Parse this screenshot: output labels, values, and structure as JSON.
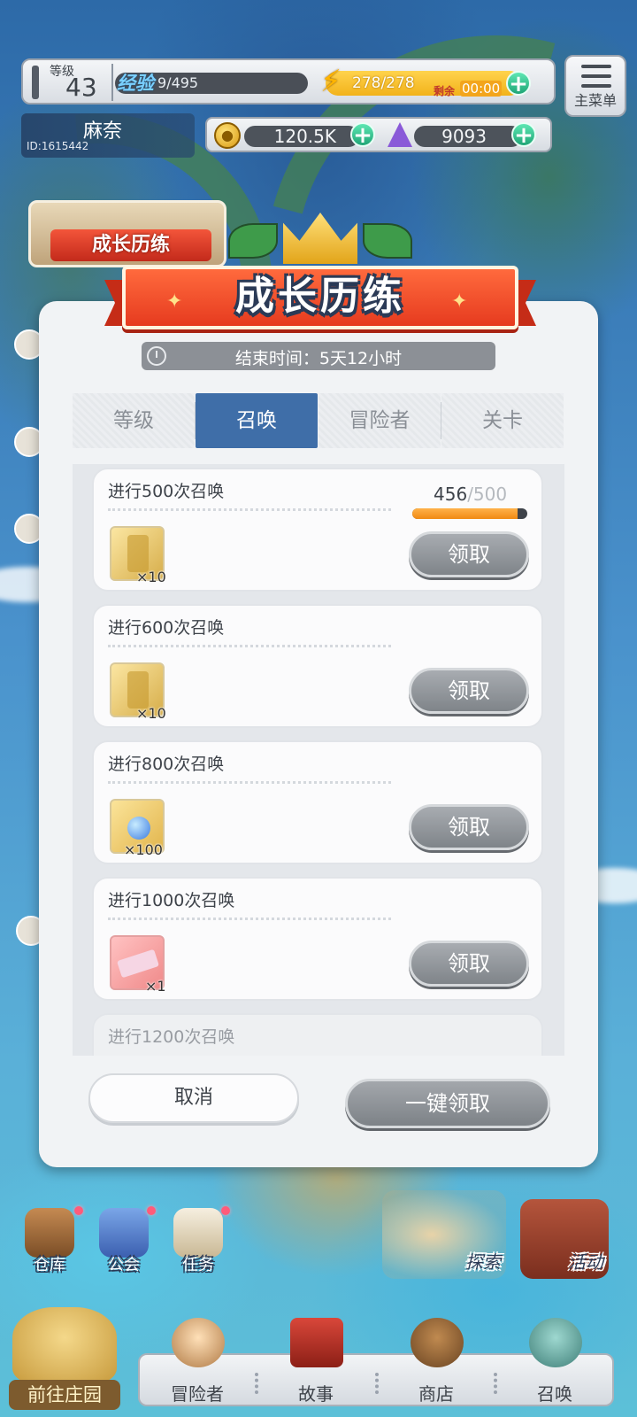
{
  "hud": {
    "level_label": "等级",
    "level_value": "43",
    "exp_label": "经验",
    "exp_value": "9/495",
    "energy_value": "278/278",
    "energy_remain_label": "剩余",
    "energy_remain_time": "00:00",
    "menu_label": "主菜单",
    "player_name": "麻奈",
    "player_id": "ID:1615442",
    "coins_value": "120.5K",
    "gems_value": "9093"
  },
  "side": {
    "event_banner_label": "成长历练"
  },
  "modal": {
    "title": "成长历练",
    "timer_text": "结束时间：5天12小时",
    "tabs": [
      {
        "label": "等级",
        "active": false
      },
      {
        "label": "召唤",
        "active": true
      },
      {
        "label": "冒险者",
        "active": false
      },
      {
        "label": "关卡",
        "active": false
      }
    ],
    "tasks": [
      {
        "title": "进行500次召唤",
        "reward_qty": "×10",
        "reward_icon": "summon-ticket-icon",
        "button": "领取",
        "progress_current": "456",
        "progress_max": "/500",
        "progress_fraction": 0.912
      },
      {
        "title": "进行600次召唤",
        "reward_qty": "×10",
        "reward_icon": "summon-ticket-icon",
        "button": "领取"
      },
      {
        "title": "进行800次召唤",
        "reward_qty": "×100",
        "reward_icon": "crystal-icon",
        "button": "领取"
      },
      {
        "title": "进行1000次召唤",
        "reward_qty": "×1",
        "reward_icon": "special-ticket-icon",
        "button": "领取"
      },
      {
        "title": "进行1200次召唤"
      }
    ],
    "cancel_label": "取消",
    "claim_all_label": "一键领取"
  },
  "shortcuts": {
    "warehouse": "仓库",
    "guild": "公会",
    "mission": "任务",
    "explore": "探索",
    "activity": "活动",
    "farm": "前往庄园"
  },
  "nav": {
    "items": [
      "冒险者",
      "故事",
      "商店",
      "召唤"
    ]
  },
  "colors": {
    "accent_blue": "#3f6ea8",
    "ribbon_red": "#e63b1f",
    "progress_orange": "#f08a12",
    "plus_green": "#1fa576"
  }
}
